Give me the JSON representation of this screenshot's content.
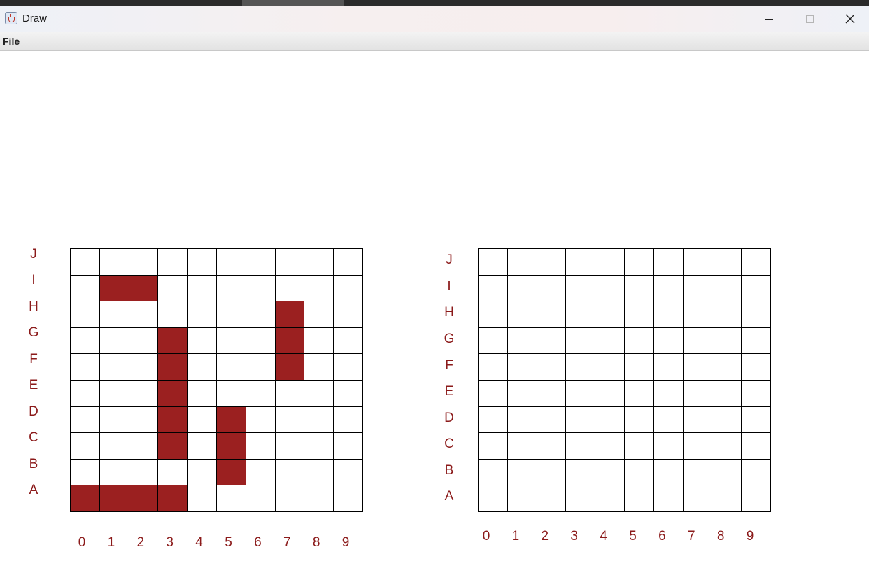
{
  "window": {
    "title": "Draw"
  },
  "menu": {
    "file": "File"
  },
  "board_colors": {
    "hit": "#9b2020",
    "label": "#8b1a1a",
    "grid": "#000000"
  },
  "boards": [
    {
      "name": "left",
      "row_labels": [
        "J",
        "I",
        "H",
        "G",
        "F",
        "E",
        "D",
        "C",
        "B",
        "A"
      ],
      "col_labels": [
        "0",
        "1",
        "2",
        "3",
        "4",
        "5",
        "6",
        "7",
        "8",
        "9"
      ],
      "filled": [
        "I1",
        "I2",
        "H7",
        "G7",
        "F7",
        "G3",
        "F3",
        "E3",
        "D3",
        "C3",
        "D5",
        "C5",
        "B5",
        "A0",
        "A1",
        "A2",
        "A3"
      ]
    },
    {
      "name": "right",
      "row_labels": [
        "J",
        "I",
        "H",
        "G",
        "F",
        "E",
        "D",
        "C",
        "B",
        "A"
      ],
      "col_labels": [
        "0",
        "1",
        "2",
        "3",
        "4",
        "5",
        "6",
        "7",
        "8",
        "9"
      ],
      "filled": []
    }
  ]
}
